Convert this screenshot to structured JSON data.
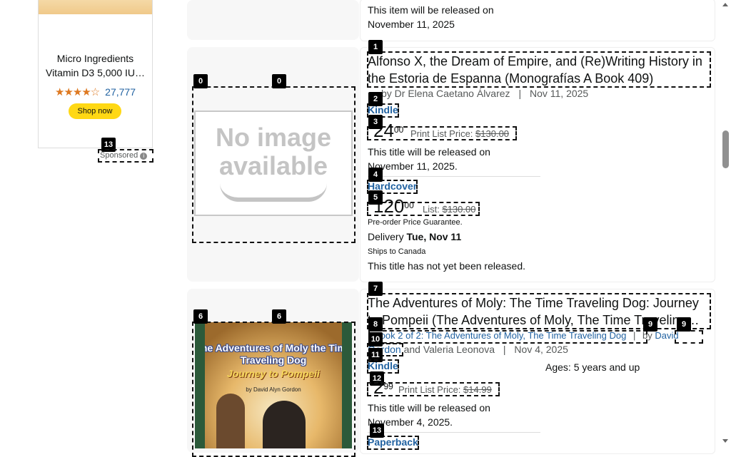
{
  "ad": {
    "title": "Micro Ingredients Vitamin D3 5,000 IU…",
    "stars": "★★★★☆",
    "rating_count": "27,777",
    "button": "Shop now",
    "sponsored": "Sponsored"
  },
  "top_item": {
    "release_line1": "This item will be released on",
    "release_line2": "November 11, 2025"
  },
  "result1": {
    "title": "Alfonso X, the Dream of Empire, and (Re)Writing History in the Estoria de Espanna (Monografías A Book 409)",
    "byline": "by Dr Elena Caetano Álvarez",
    "sep": "|",
    "date": "Nov 11, 2025",
    "image_text_line1": "No image",
    "image_text_line2": "available",
    "formats": [
      {
        "name": "Kindle",
        "currency": "$",
        "whole": "24",
        "frac": "00",
        "list_label": "Print List Price:",
        "list_price": "$130.00",
        "release1": "This title will be released on",
        "release2": "November 11, 2025."
      },
      {
        "name": "Hardcover",
        "currency": "$",
        "whole": "120",
        "frac": "00",
        "list_label": "List:",
        "list_price": "$130.00",
        "guarantee": "Pre-order Price Guarantee.",
        "delivery_label": "Delivery",
        "delivery_date": "Tue, Nov 11",
        "ships": "Ships to Canada",
        "not_released": "This title has not yet been released."
      }
    ]
  },
  "result2": {
    "title": "The Adventures of Moly: The Time Traveling Dog: Journey to Pompeii (The Adventures of Moly, The Time Traveling…",
    "series": "Book 2 of 2: The Adventures of Moly, The Time Traveling Dog",
    "by": "by",
    "author_first": "David",
    "author_rest": "Gordon",
    "coauthor": "and Valeria Leonova",
    "sep": "|",
    "date": "Nov 4, 2025",
    "ages": "Ages: 5 years and up",
    "cover": {
      "title": "The Adventures of Moly the Time Traveling Dog",
      "subtitle": "Journey to Pompeii",
      "author": "by David Alyn Gordon"
    },
    "formats": [
      {
        "name": "Kindle",
        "currency": "$",
        "whole": "2",
        "frac": "99",
        "list_label": "Print List Price:",
        "list_price": "$14.99",
        "release1": "This title will be released on",
        "release2": "November 4, 2025."
      },
      {
        "name": "Paperback"
      }
    ]
  },
  "badges": [
    "0",
    "0",
    "1",
    "2",
    "3",
    "4",
    "5",
    "6",
    "6",
    "7",
    "8",
    "9",
    "9",
    "10",
    "11",
    "12",
    "13"
  ],
  "colors": {
    "link": "#2162a1",
    "button": "#ffd814",
    "star": "#de7921"
  }
}
